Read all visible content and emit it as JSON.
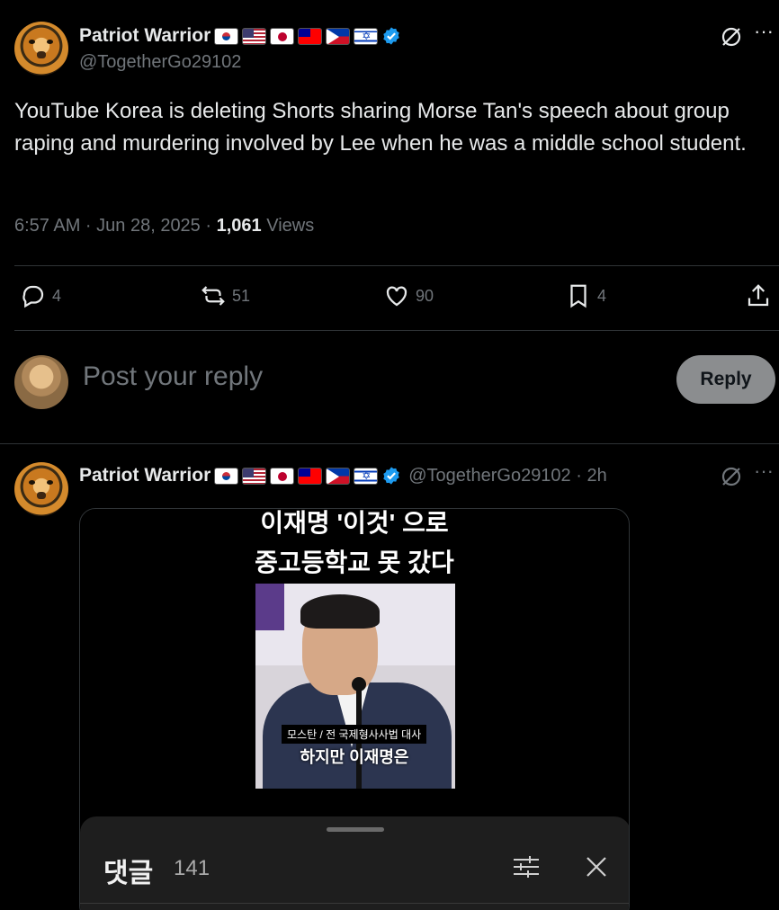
{
  "main_post": {
    "display_name": "Patriot Warrior",
    "handle": "@TogetherGo29102",
    "text": "YouTube Korea is deleting Shorts sharing Morse Tan's speech about group raping and murdering involved by Lee when he was a middle school student.",
    "time": "6:57 AM · Jun 28, 2025 · ",
    "views_count": "1,061",
    "views_label": " Views",
    "actions": {
      "replies": "4",
      "reposts": "51",
      "likes": "90",
      "bookmarks": "4"
    }
  },
  "reply_box": {
    "placeholder": "Post your reply",
    "button_label": "Reply"
  },
  "reply_post": {
    "display_name": "Patriot Warrior",
    "handle_time": "@TogetherGo29102 · 2h",
    "video": {
      "caption_top": "이재명 '이것' 으로",
      "caption_main": "중고등학교 못 갔다",
      "speaker_tag": "모스탄 / 전 국제형사사법 대사",
      "subtitle": "하지만 이재명은",
      "comments_title": "댓글",
      "comments_count": "141"
    }
  },
  "colors": {
    "background": "#000000",
    "text_primary": "#e7e9ea",
    "text_secondary": "#71767b",
    "verified_blue": "#1d9bf0",
    "divider": "#2f3336",
    "reply_button_bg": "#8b8d8f"
  }
}
